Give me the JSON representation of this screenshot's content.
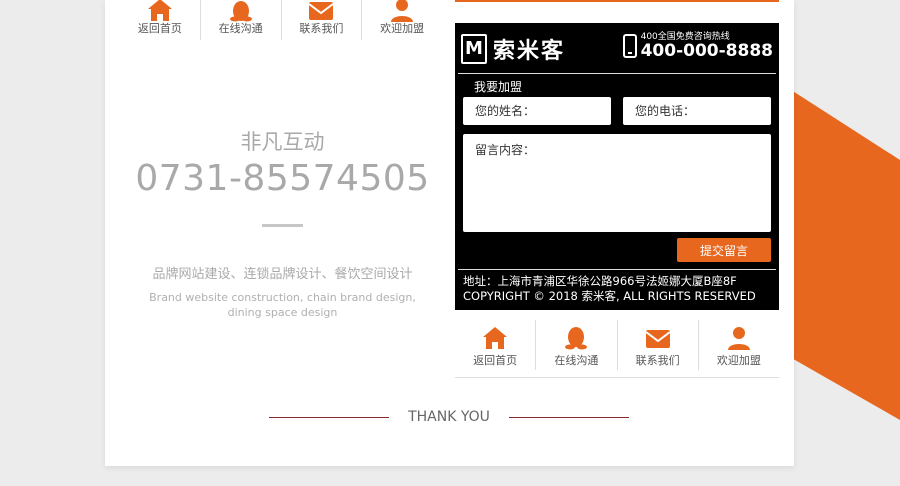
{
  "nav_items": [
    {
      "icon": "home-icon",
      "label": "返回首页"
    },
    {
      "icon": "qq-penguin-icon",
      "label": "在线沟通"
    },
    {
      "icon": "mail-icon",
      "label": "联系我们"
    },
    {
      "icon": "user-icon",
      "label": "欢迎加盟"
    }
  ],
  "company": {
    "name": "非凡互动",
    "phone": "0731-85574505",
    "services_cn": "品牌网站建设、连锁品牌设计、餐饮空间设计",
    "services_en": "Brand website construction, chain brand design, dining space design"
  },
  "panel": {
    "logo_letter": "M",
    "brand": "索米客",
    "hotline_label": "400全国免费咨询热线",
    "hotline_number": "400-000-8888",
    "form_title": "我要加盟",
    "name_placeholder": "您的姓名：",
    "phone_placeholder": "您的电话：",
    "message_placeholder": "留言内容：",
    "submit_label": "提交留言",
    "address": "地址：上海市青浦区华徐公路966号法姬娜大厦B座8F",
    "copyright": "COPYRIGHT © 2018 索米客, ALL RIGHTS RESERVED"
  },
  "thanks": "THANK YOU",
  "colors": {
    "accent": "#e8671f",
    "panel_bg": "#000000",
    "muted_text": "#a9a9a9"
  }
}
